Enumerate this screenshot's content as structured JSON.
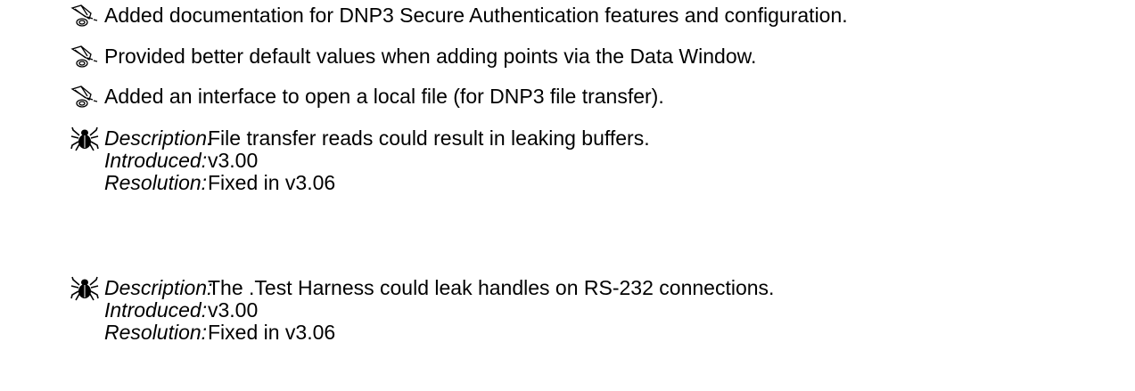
{
  "features": [
    {
      "icon": "horn-icon",
      "text": "Added documentation for DNP3 Secure Authentication features and configuration."
    },
    {
      "icon": "horn-icon",
      "text": "Provided better default values when adding points via the Data Window."
    },
    {
      "icon": "horn-icon",
      "text": "Added an interface to open a local file (for DNP3 file transfer)."
    }
  ],
  "bugs": [
    {
      "icon": "bug-icon",
      "description_label": "Description:",
      "description": "File transfer reads could result in leaking buffers.",
      "introduced_label": "Introduced:",
      "introduced": "v3.00",
      "resolution_label": "Resolution:",
      "resolution": "Fixed in v3.06"
    },
    {
      "icon": "bug-icon",
      "description_label": "Description:",
      "description": "The .Test Harness could leak handles on RS-232 connections.",
      "introduced_label": "Introduced:",
      "introduced": "v3.00",
      "resolution_label": "Resolution:",
      "resolution": "Fixed in v3.06"
    }
  ]
}
